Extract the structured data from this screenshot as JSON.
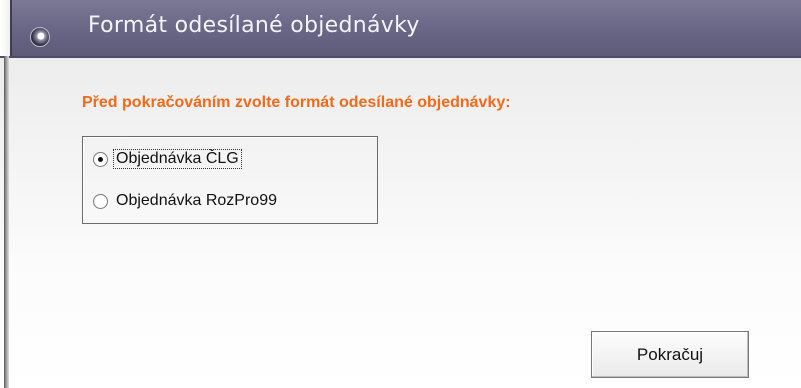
{
  "dialog": {
    "title": "Formát odesílané objednávky",
    "icon": "disc-icon",
    "prompt": "Před pokračováním zvolte formát odesílané objednávky:"
  },
  "format_options": [
    {
      "label": "Objednávka ČLG",
      "selected": true
    },
    {
      "label": "Objednávka RozPro99",
      "selected": false
    }
  ],
  "buttons": {
    "continue_label": "Pokračuj"
  },
  "colors": {
    "title_bar": "#6c6888",
    "prompt_text": "#f16a1a"
  }
}
